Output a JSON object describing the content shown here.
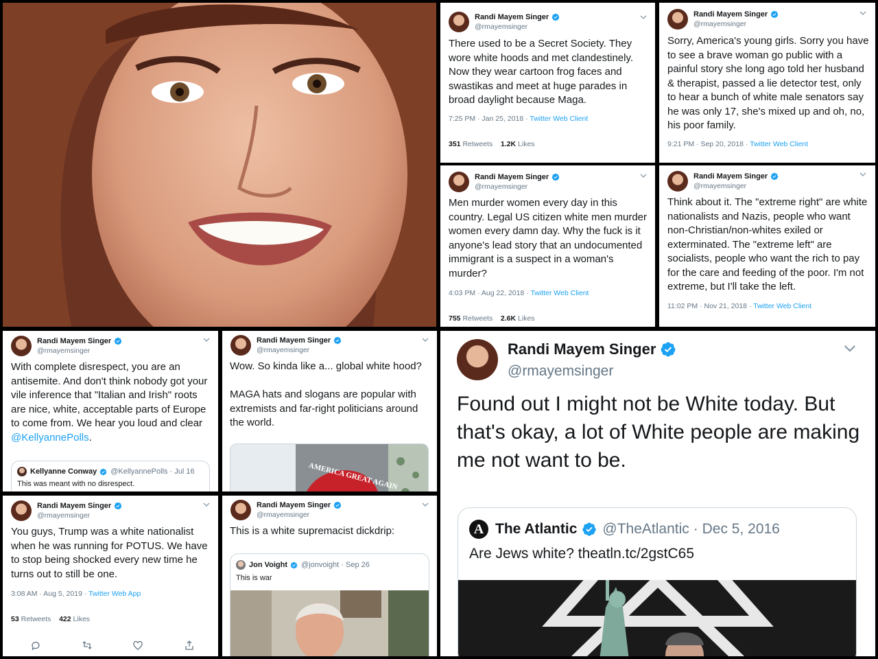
{
  "collage": [
    {
      "id": "t1",
      "author": "Randi Mayem Singer",
      "handle": "@rmayemsinger",
      "text": "There used to be a Secret Society. They wore white hoods and met clandestinely. Now they wear cartoon frog faces and swastikas and meet at huge parades in broad daylight because Maga.",
      "time": "7:25 PM · Jan 25, 2018 · ",
      "client": "Twitter Web Client",
      "retweets": "351",
      "retweets_label": "Retweets",
      "likes": "1.2K",
      "likes_label": "Likes"
    },
    {
      "id": "t2",
      "author": "Randi Mayem Singer",
      "handle": "@rmayemsinger",
      "text": "Sorry, America's young girls. Sorry you have to see a brave woman go public with a painful story she long ago told her husband & therapist, passed a lie detector test, only to hear a bunch of white male senators say he was only 17, she's mixed up and oh, no, his poor family.",
      "time": "9:21 PM · Sep 20, 2018 · ",
      "client": "Twitter Web Client"
    },
    {
      "id": "t3",
      "author": "Randi Mayem Singer",
      "handle": "@rmayemsinger",
      "text": "Men murder women every day in this country. Legal US citizen white men murder women every damn day. Why the fuck is it anyone's lead story that an undocumented immigrant is a suspect in a woman's murder?",
      "time": "4:03 PM · Aug 22, 2018 · ",
      "client": "Twitter Web Client",
      "retweets": "755",
      "retweets_label": "Retweets",
      "likes": "2.6K",
      "likes_label": "Likes"
    },
    {
      "id": "t4",
      "author": "Randi Mayem Singer",
      "handle": "@rmayemsinger",
      "text": "Think about it. The \"extreme right\" are white nationalists and Nazis, people who want non-Christian/non-whites exiled or exterminated. The \"extreme left\" are socialists, people who want the rich to pay for the care and feeding of the poor. I'm not extreme, but I'll take the left.",
      "time": "11:02 PM · Nov 21, 2018 · ",
      "client": "Twitter Web Client"
    },
    {
      "id": "t5",
      "author": "Randi Mayem Singer",
      "handle": "@rmayemsinger",
      "text": "With complete disrespect, you are an antisemite. And don't think nobody got your vile inference that \"Italian and Irish\" roots are nice, white, acceptable parts of Europe to come from. We hear you loud and clear ",
      "mention": "@KellyannePolls",
      "period": ".",
      "quote_author": "Kellyanne Conway",
      "quote_handle": "@KellyannePolls · Jul 16",
      "quote_text": "This was meant with no disrespect."
    },
    {
      "id": "t6",
      "author": "Randi Mayem Singer",
      "handle": "@rmayemsinger",
      "text1": "Wow. So kinda like a... global white hood?",
      "text2": "MAGA hats and slogans are popular with extremists and far-right politicians around the world.",
      "hat_text": "AMERICA GREAT AGAIN"
    },
    {
      "id": "t7",
      "author": "Randi Mayem Singer",
      "handle": "@rmayemsinger",
      "text": "You guys, Trump was a white nationalist when he was running for POTUS. We have to stop being shocked every new time he turns out to still be one.",
      "time": "3:08 AM · Aug 5, 2019 · ",
      "client": "Twitter Web App",
      "retweets": "53",
      "retweets_label": "Retweets",
      "likes": "422",
      "likes_label": "Likes",
      "actions": [
        "reply-icon",
        "retweet-icon",
        "like-icon",
        "share-icon"
      ]
    },
    {
      "id": "t8",
      "author": "Randi Mayem Singer",
      "handle": "@rmayemsinger",
      "text": "This is a white supremacist dickdrip:",
      "quote_author": "Jon Voight",
      "quote_handle": "@jonvoight · Sep 26",
      "quote_text": "This is war"
    },
    {
      "id": "t9",
      "author": "Randi Mayem Singer",
      "handle": "@rmayemsinger",
      "text": "Found out I might not be White today.  But that's okay, a lot of White people are making me not want to be.",
      "quote_author": "The Atlantic",
      "quote_handle": "@TheAtlantic",
      "quote_date": "· Dec 5, 2016",
      "quote_text": "Are Jews white? theatln.tc/2gstC65",
      "quote_logo": "A"
    }
  ],
  "colors": {
    "twitter_blue": "#1da1f2",
    "text": "#14171a",
    "muted": "#657786",
    "border": "#ccd6dd"
  }
}
